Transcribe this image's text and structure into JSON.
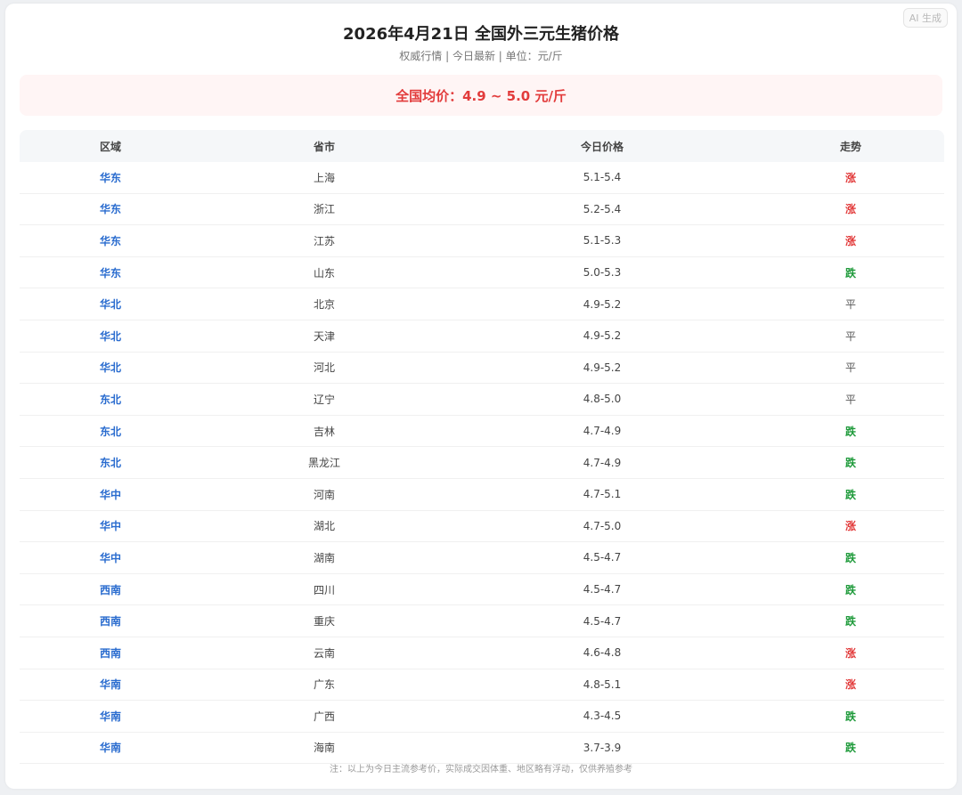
{
  "badge": "AI 生成",
  "title": "2026年4月21日 全国外三元生猪价格",
  "subtitle": "权威行情 | 今日最新 | 单位：元/斤",
  "national_avg": "全国均价：4.9 ~ 5.0 元/斤",
  "table": {
    "headers": [
      "区域",
      "省市",
      "今日价格",
      "走势"
    ],
    "rows": [
      {
        "region": "华东",
        "province": "上海",
        "price": "5.1-5.4",
        "trend": "涨"
      },
      {
        "region": "华东",
        "province": "浙江",
        "price": "5.2-5.4",
        "trend": "涨"
      },
      {
        "region": "华东",
        "province": "江苏",
        "price": "5.1-5.3",
        "trend": "涨"
      },
      {
        "region": "华东",
        "province": "山东",
        "price": "5.0-5.3",
        "trend": "跌"
      },
      {
        "region": "华北",
        "province": "北京",
        "price": "4.9-5.2",
        "trend": "平"
      },
      {
        "region": "华北",
        "province": "天津",
        "price": "4.9-5.2",
        "trend": "平"
      },
      {
        "region": "华北",
        "province": "河北",
        "price": "4.9-5.2",
        "trend": "平"
      },
      {
        "region": "东北",
        "province": "辽宁",
        "price": "4.8-5.0",
        "trend": "平"
      },
      {
        "region": "东北",
        "province": "吉林",
        "price": "4.7-4.9",
        "trend": "跌"
      },
      {
        "region": "东北",
        "province": "黑龙江",
        "price": "4.7-4.9",
        "trend": "跌"
      },
      {
        "region": "华中",
        "province": "河南",
        "price": "4.7-5.1",
        "trend": "跌"
      },
      {
        "region": "华中",
        "province": "湖北",
        "price": "4.7-5.0",
        "trend": "涨"
      },
      {
        "region": "华中",
        "province": "湖南",
        "price": "4.5-4.7",
        "trend": "跌"
      },
      {
        "region": "西南",
        "province": "四川",
        "price": "4.5-4.7",
        "trend": "跌"
      },
      {
        "region": "西南",
        "province": "重庆",
        "price": "4.5-4.7",
        "trend": "跌"
      },
      {
        "region": "西南",
        "province": "云南",
        "price": "4.6-4.8",
        "trend": "涨"
      },
      {
        "region": "华南",
        "province": "广东",
        "price": "4.8-5.1",
        "trend": "涨"
      },
      {
        "region": "华南",
        "province": "广西",
        "price": "4.3-4.5",
        "trend": "跌"
      },
      {
        "region": "华南",
        "province": "海南",
        "price": "3.7-3.9",
        "trend": "跌"
      }
    ]
  },
  "note": "注：以上为今日主流参考价，实际成交因体重、地区略有浮动，仅供养殖参考",
  "colors": {
    "up": "#e23b3b",
    "down": "#1e9a3a",
    "flat": "#555555",
    "region": "#2a6ccf"
  }
}
